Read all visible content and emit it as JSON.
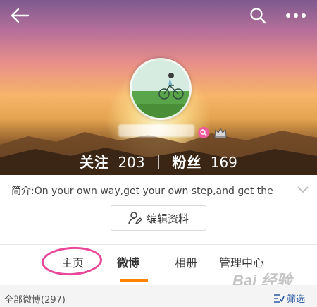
{
  "header": {
    "stats": {
      "following_label": "关注",
      "following_count": "203",
      "separator": "|",
      "followers_label": "粉丝",
      "followers_count": "169"
    }
  },
  "profile": {
    "intro": "简介:On your own way,get your own step,and get the",
    "edit_button": "编辑资料"
  },
  "tabs": [
    {
      "label": "主页"
    },
    {
      "label": "微博"
    },
    {
      "label": "相册"
    },
    {
      "label": "管理中心"
    }
  ],
  "feed": {
    "all_label": "全部微博(297)",
    "filter_label": "筛选"
  },
  "watermark": "Bai 经验",
  "colors": {
    "accent": "#ff8200",
    "annotation": "#e9479a",
    "link": "#2d5aa0"
  }
}
